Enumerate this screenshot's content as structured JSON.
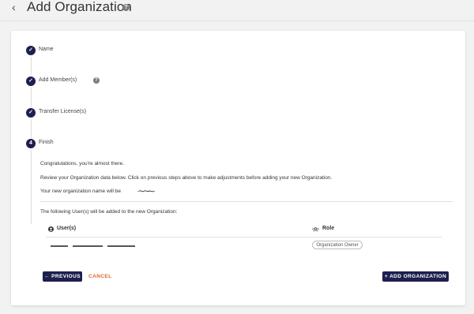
{
  "header": {
    "back_icon": "chevron-left-icon",
    "title": "Add Organization",
    "help_icon": "question-circle-icon"
  },
  "steps": [
    {
      "label": "Name",
      "state": "completed",
      "icon": "check-icon"
    },
    {
      "label": "Add Member(s)",
      "state": "completed",
      "icon": "check-icon",
      "help_icon": "question-circle-icon"
    },
    {
      "label": "Transfer License(s)",
      "state": "completed",
      "icon": "check-icon"
    },
    {
      "label": "Finish",
      "state": "active",
      "number": "4"
    }
  ],
  "finish": {
    "congrats": "Congratulations, you're almost there.",
    "review": "Review your Organization data below. Click on previous steps above to make adjustments before adding your new Organization.",
    "orgname_prefix": "Your new organization name will be",
    "users_intro": "The following User(s) will be added to the new Organization:"
  },
  "table": {
    "columns": [
      {
        "label": "User(s)",
        "icon": "user-circle-icon"
      },
      {
        "label": "Role",
        "icon": "users-icon"
      }
    ],
    "rows": [
      {
        "user": "",
        "role": "Organization Owner"
      }
    ]
  },
  "actions": {
    "previous": "PREVIOUS",
    "cancel": "CANCEL",
    "add": "ADD ORGANIZATION"
  },
  "colors": {
    "primary": "#1d1f4f",
    "cancel": "#e0642c"
  }
}
